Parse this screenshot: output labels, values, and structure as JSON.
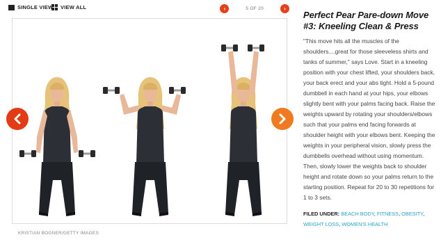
{
  "toolbar": {
    "single_view": "SINGLE VIEW",
    "view_all": "VIEW ALL",
    "counter": "5 OF 20",
    "prev_glyph": "‹",
    "next_glyph": "›"
  },
  "slide": {
    "credit": "KRISTIAN BOGNER/GETTY IMAGES",
    "prev_icon": "chevron-left-icon",
    "next_icon": "chevron-right-icon"
  },
  "article": {
    "title": "Perfect Pear Pare-down Move #3: Kneeling Clean & Press",
    "body": "\"This move hits all the muscles of the shoulders....great for those sleeveless shirts and tanks of summer,\" says Love. Start in a kneeling position with your chest lifted, your shoulders back, your back erect and your abs tight. Hold a 5-pound dumbbell in each hand at your hips, your elbows slightly bent with your palms facing back. Raise the weights upward by rotating your shoulders/elbows such that your palms end facing forwards at shoulder height with your elbows bent. Keeping the weights in your peripheral vision, slowly press the dumbbells overhead without using momentum. Then, slowly lower the weights back to shoulder height and rotate down so your palms return to the starting position. Repeat for 20 to 30 repetitions for 1 to 3 sets.",
    "filed_label": "FILED UNDER:",
    "tags": [
      "BEACH BODY",
      "FITNESS",
      "OBESITY",
      "WEIGHT LOSS",
      "WOMEN'S HEALTH"
    ]
  },
  "colors": {
    "arrow_prev": "#e23b16",
    "arrow_next": "#f07a1f",
    "tag_link": "#2aa3c9"
  }
}
